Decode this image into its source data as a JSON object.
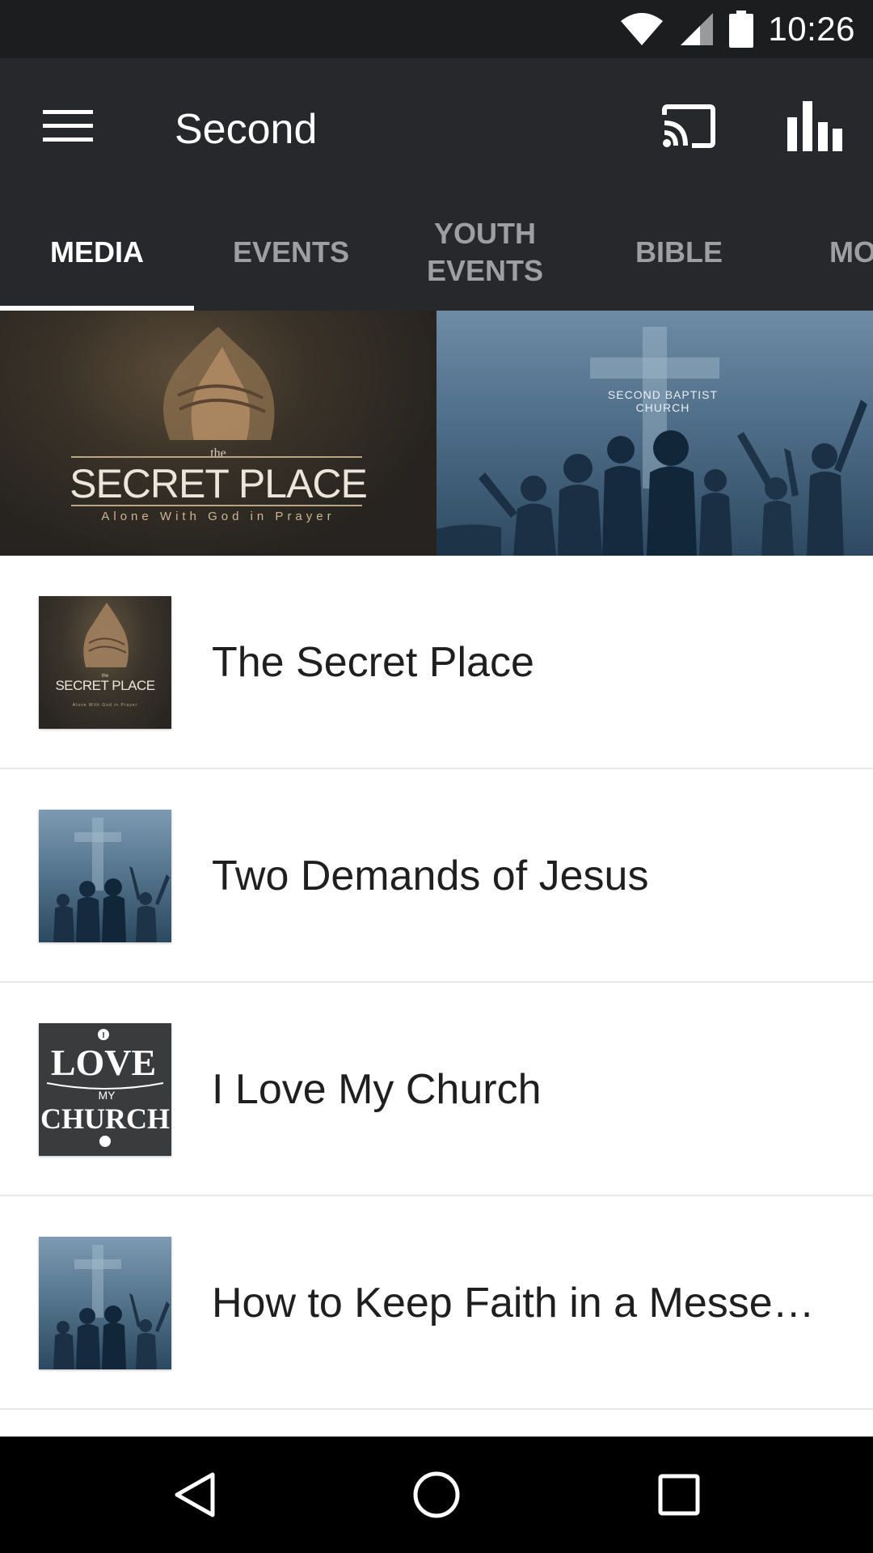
{
  "status_bar": {
    "time": "10:26",
    "icons": [
      "wifi-icon",
      "cell-signal-icon",
      "battery-icon"
    ]
  },
  "app_bar": {
    "title": "Second",
    "menu_icon": "hamburger-menu-icon",
    "cast_icon": "cast-icon",
    "stats_icon": "bar-chart-icon"
  },
  "tabs": [
    {
      "label": "MEDIA",
      "active": true
    },
    {
      "label": "EVENTS",
      "active": false
    },
    {
      "label": "YOUTH EVENTS",
      "active": false
    },
    {
      "label": "BIBLE",
      "active": false
    },
    {
      "label": "MO",
      "active": false
    }
  ],
  "hero": {
    "left": {
      "title_small": "the",
      "title": "SECRET PLACE",
      "subtitle": "Alone With God in Prayer"
    },
    "right": {
      "church_name": "SECOND BAPTIST CHURCH"
    }
  },
  "media_list": [
    {
      "title": "The Secret Place",
      "thumb": "secret-place-thumbnail"
    },
    {
      "title": "Two Demands of Jesus",
      "thumb": "worship-silhouette-thumbnail"
    },
    {
      "title": "I Love My Church",
      "thumb": "i-love-my-church-thumbnail",
      "thumb_text": [
        "I",
        "LOVE",
        "MY",
        "CHURCH"
      ]
    },
    {
      "title": "How to Keep Faith in a Messe…",
      "thumb": "worship-silhouette-thumbnail"
    }
  ],
  "colors": {
    "status_bar": "#1c1d1f",
    "app_bar": "#27282b",
    "tab_active": "#ffffff",
    "tab_inactive": "#9e9fa2",
    "list_divider": "#e6e6e6",
    "nav_bar": "#000000"
  },
  "nav_bar": {
    "icons": [
      "back-icon",
      "home-icon",
      "recents-icon"
    ]
  }
}
